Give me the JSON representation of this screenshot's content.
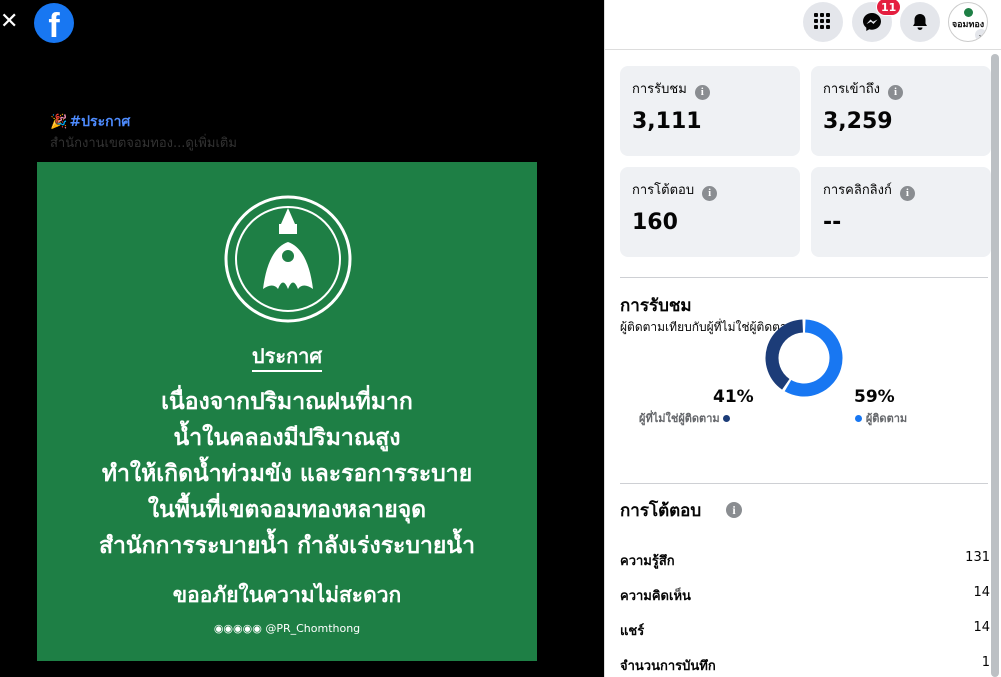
{
  "viewer": {
    "close_glyph": "✕",
    "logo_glyph": "f",
    "caption_hashtag": "#ประกาศ",
    "caption_sub": "สำนักงานเขตจอมทอง...ดูเพิ่มเติม",
    "poster": {
      "title": "ประกาศ",
      "lines": [
        "เนื่องจากปริมาณฝนที่มาก",
        "น้ำในคลองมีปริมาณสูง",
        "ทำให้เกิดน้ำท่วมขัง และรอการระบาย",
        "ในพื้นที่เขตจอมทองหลายจุด",
        "สำนักการระบายน้ำ กำลังเร่งระบายน้ำ"
      ],
      "apology": "ขออภัยในความไม่สะดวก",
      "handle": "◉◉◉◉◉ @PR_Chomthong",
      "bg_color": "#1e7f45"
    }
  },
  "topbar": {
    "messenger_badge": "11",
    "avatar_text": "จอมทอง",
    "icons": [
      "menu-grid-icon",
      "messenger-icon",
      "bell-icon",
      "chevron-down-icon"
    ]
  },
  "stats": {
    "views_label": "การรับชม",
    "views_value": "3,111",
    "reach_label": "การเข้าถึง",
    "reach_value": "3,259",
    "engagement_label": "การโต้ตอบ",
    "engagement_value": "160",
    "link_clicks_label": "การคลิกลิงก์",
    "link_clicks_value": "--",
    "info_glyph": "i"
  },
  "views_section": {
    "title": "การรับชม",
    "subtitle": "ผู้ติดตามเทียบกับผู้ที่ไม่ใช่ผู้ติดตาม",
    "non_followers_pct": "41%",
    "non_followers_label": "ผู้ที่ไม่ใช่ผู้ติดตาม",
    "followers_pct": "59%",
    "followers_label": "ผู้ติดตาม",
    "colors": {
      "followers": "#1877f2",
      "non_followers": "#1c3c78"
    }
  },
  "chart_data": {
    "type": "pie",
    "categories": [
      "ผู้ติดตาม",
      "ผู้ที่ไม่ใช่ผู้ติดตาม"
    ],
    "values": [
      59,
      41
    ]
  },
  "engagement_section": {
    "title": "การโต้ตอบ",
    "rows": [
      {
        "label": "ความรู้สึก",
        "value": "131"
      },
      {
        "label": "ความคิดเห็น",
        "value": "14"
      },
      {
        "label": "แชร์",
        "value": "14"
      },
      {
        "label": "จำนวนการบันทึก",
        "value": "1"
      }
    ]
  }
}
